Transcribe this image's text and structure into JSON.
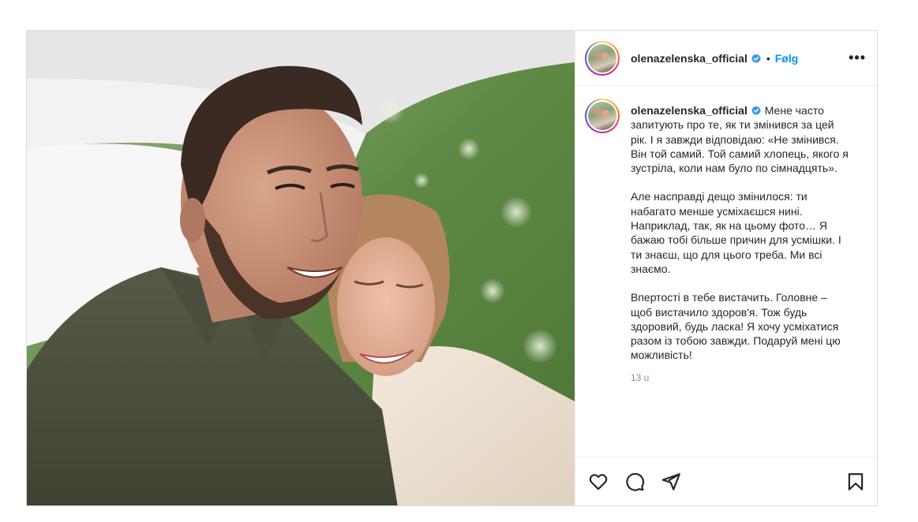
{
  "post": {
    "username": "olenazelenska_official",
    "follow_label": "Følg",
    "separator": "•",
    "more_label": "•••",
    "icons": {
      "verified": "verified-badge-icon",
      "like": "heart-icon",
      "comment": "comment-icon",
      "share": "paper-plane-icon",
      "save": "bookmark-icon",
      "more": "more-options-icon"
    },
    "caption": {
      "username": "olenazelenska_official",
      "paragraphs": [
        "Мене часто запитують про те, як ти змінився за цей рік. І я завжди відповідаю: «Не змінився. Він той самий. Той самий хлопець, якого я зустріла, коли нам було по сімнадцять».",
        "Але насправді дещо змінилося: ти набагато менше усміхаєшся нині. Наприклад, так, як на цьому фото… Я бажаю тобі більше причин для усмішки. І ти знаєш, що для цього треба. Ми всі знаємо.",
        "Впертості в тебе вистачить. Головне – щоб вистачило здоров'я. Тож будь здоровий, будь ласка! Я хочу усміхатися разом із тобою завжди. Подаруй мені цю можливість!"
      ],
      "timestamp": "13 u"
    },
    "colors": {
      "follow": "#0095f6",
      "verified": "#3897f0",
      "text": "#262626",
      "muted": "#8e8e8e"
    }
  }
}
